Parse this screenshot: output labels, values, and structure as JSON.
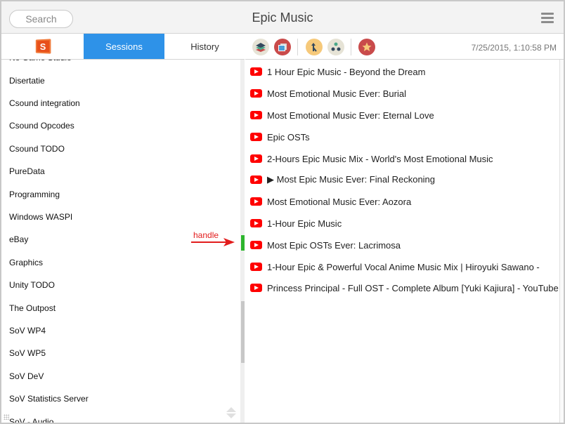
{
  "window": {
    "title": "Epic Music",
    "search_placeholder": "Search",
    "menu_icon": "hamburger-menu-icon"
  },
  "left_panel": {
    "tabs": [
      {
        "label": "",
        "icon": "app-logo-icon",
        "logo_letter": "S"
      },
      {
        "label": "Sessions",
        "active": true
      },
      {
        "label": "History",
        "active": false
      }
    ],
    "sessions": [
      "No Game Studio",
      "Disertatie",
      "Csound integration",
      "Csound Opcodes",
      "Csound TODO",
      "PureData",
      "Programming",
      "Windows WASPI",
      "eBay",
      "Graphics",
      "Unity TODO",
      "The Outpost",
      "SoV WP4",
      "SoV WP5",
      "SoV DeV",
      "SoV Statistics Server",
      "SoV - Audio"
    ]
  },
  "annotation": {
    "label": "handle",
    "color": "#e21c1c"
  },
  "toolbar": {
    "icons": [
      {
        "name": "layers-icon",
        "bg": "#e6e3d6"
      },
      {
        "name": "photos-icon",
        "bg": "#c94b4b"
      },
      {
        "name": "merge-icon",
        "bg": "#f6c97a"
      },
      {
        "name": "recycle-icon",
        "bg": "#e6e3d6"
      },
      {
        "name": "star-icon",
        "bg": "#c94b4b"
      }
    ],
    "timestamp": "7/25/2015, 1:10:58 PM"
  },
  "videos": [
    "1 Hour Epic Music - Beyond the Dream",
    "Most Emotional Music Ever: Burial",
    "Most Emotional Music Ever: Eternal Love",
    "Epic OSTs",
    "2-Hours Epic Music Mix - World's Most Emotional Music",
    "▶ Most Epic Music Ever: Final Reckoning",
    "Most Emotional Music Ever: Aozora",
    "1-Hour Epic Music",
    "Most Epic OSTs Ever: Lacrimosa",
    "1-Hour Epic & Powerful Vocal Anime Music Mix | Hiroyuki Sawano - ",
    "Princess Principal - Full OST - Complete Album [Yuki Kajiura] - YouTube"
  ],
  "colors": {
    "accent": "#2e92e8",
    "handle": "#2db52d",
    "youtube": "#ff0000"
  }
}
